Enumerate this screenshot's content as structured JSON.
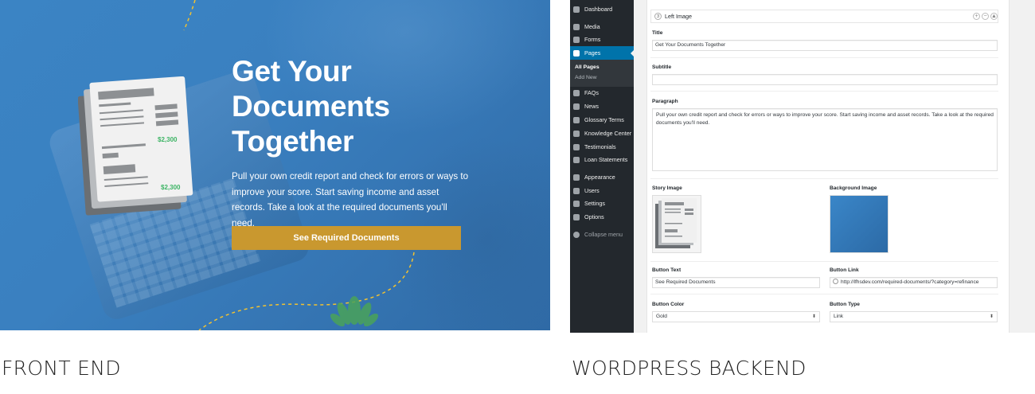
{
  "front_end": {
    "title_lines": [
      "Get Your",
      "Documents",
      "Together"
    ],
    "paragraph": "Pull your own credit report and check for errors or ways to improve your score. Start saving income and asset records. Take a look at the required documents you'll need.",
    "button_label": "See Required Documents",
    "doc_amount": "$2,300",
    "colors": {
      "background": "#3a80c0",
      "button": "#c9982f",
      "dash": "#f2c230",
      "amount": "#3cb464"
    }
  },
  "captions": {
    "left": "FRONT END",
    "right": "WORDPRESS BACKEND"
  },
  "wp": {
    "sidebar": {
      "items": [
        {
          "label": "Dashboard",
          "icon": "dashboard-icon"
        },
        {
          "label": "Media",
          "icon": "media-icon"
        },
        {
          "label": "Forms",
          "icon": "forms-icon"
        },
        {
          "label": "Pages",
          "icon": "pages-icon",
          "active": true
        },
        {
          "label": "FAQs",
          "icon": "faqs-icon"
        },
        {
          "label": "News",
          "icon": "news-icon"
        },
        {
          "label": "Glossary Terms",
          "icon": "glossary-icon"
        },
        {
          "label": "Knowledge Center",
          "icon": "knowledge-icon"
        },
        {
          "label": "Testimonials",
          "icon": "testimonials-icon"
        },
        {
          "label": "Loan Statements",
          "icon": "loan-statements-icon"
        },
        {
          "label": "Appearance",
          "icon": "appearance-icon"
        },
        {
          "label": "Users",
          "icon": "users-icon"
        },
        {
          "label": "Settings",
          "icon": "settings-icon"
        },
        {
          "label": "Options",
          "icon": "options-icon"
        },
        {
          "label": "Collapse menu",
          "icon": "collapse-icon"
        }
      ],
      "submenu": [
        "All Pages",
        "Add New"
      ]
    },
    "layout": {
      "number": "3",
      "title": "Left Image",
      "controls": [
        "+",
        "−",
        "▲"
      ]
    },
    "fields": {
      "title_label": "Title",
      "title_value": "Get Your Documents Together",
      "subtitle_label": "Subtitle",
      "subtitle_value": "",
      "paragraph_label": "Paragraph",
      "paragraph_value": "Pull your own credit report and check for errors or ways to improve your score. Start saving income and asset records. Take a look at the required documents you'll need.",
      "story_image_label": "Story Image",
      "background_image_label": "Background Image",
      "button_text_label": "Button Text",
      "button_text_value": "See Required Documents",
      "button_link_label": "Button Link",
      "button_link_value": "http://lfhsdev.com/required-documents/?category=refinance",
      "button_color_label": "Button Color",
      "button_color_value": "Gold",
      "button_type_label": "Button Type",
      "button_type_value": "Link"
    },
    "colors": {
      "sidebar": "#23282d",
      "active": "#0073aa"
    }
  }
}
